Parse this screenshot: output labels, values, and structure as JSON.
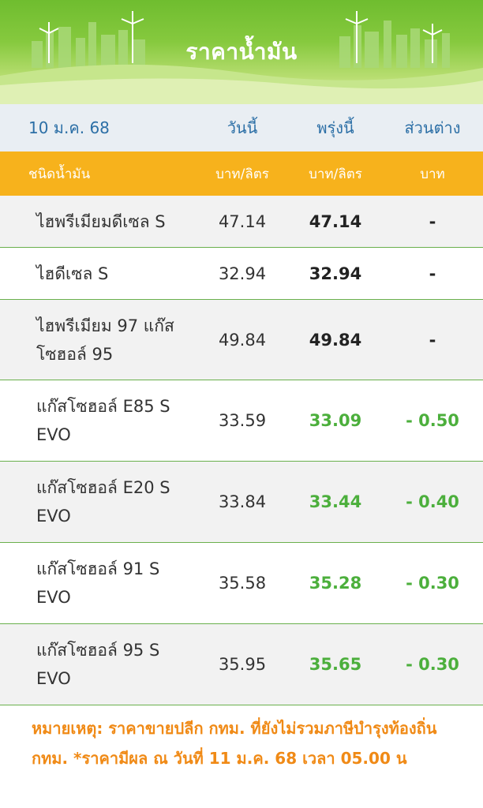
{
  "banner": {
    "title": "ราคาน้ำมัน"
  },
  "header": {
    "date": "10 ม.ค. 68",
    "today": "วันนี้",
    "tomorrow": "พรุ่งนี้",
    "diff": "ส่วนต่าง"
  },
  "columns": {
    "fuel_type": "ชนิดน้ำมัน",
    "today_unit": "บาท/ลิตร",
    "tomorrow_unit": "บาท/ลิตร",
    "diff_unit": "บาท"
  },
  "rows": [
    {
      "name": "ไฮพรีเมียมดีเซล S",
      "today": "47.14",
      "tomorrow": "47.14",
      "diff": "-",
      "trend": "same"
    },
    {
      "name": "ไฮดีเซล S",
      "today": "32.94",
      "tomorrow": "32.94",
      "diff": "-",
      "trend": "same"
    },
    {
      "name": "ไฮพรีเมียม 97 แก๊สโซฮอล์ 95",
      "today": "49.84",
      "tomorrow": "49.84",
      "diff": "-",
      "trend": "same"
    },
    {
      "name": "แก๊สโซฮอล์ E85 S EVO",
      "today": "33.59",
      "tomorrow": "33.09",
      "diff": "- 0.50",
      "trend": "down"
    },
    {
      "name": "แก๊สโซฮอล์ E20 S EVO",
      "today": "33.84",
      "tomorrow": "33.44",
      "diff": "- 0.40",
      "trend": "down"
    },
    {
      "name": "แก๊สโซฮอล์ 91 S EVO",
      "today": "35.58",
      "tomorrow": "35.28",
      "diff": "- 0.30",
      "trend": "down"
    },
    {
      "name": "แก๊สโซฮอล์ 95 S EVO",
      "today": "35.95",
      "tomorrow": "35.65",
      "diff": "- 0.30",
      "trend": "down"
    }
  ],
  "note": "หมายเหตุ: ราคาขายปลีก กทม. ที่ยังไม่รวมภาษีบำรุงท้องถิ่น กทม. *ราคามีผล ณ วันที่ 11 ม.ค. 68 เวลา 05.00 น",
  "colors": {
    "accent": "#f7b21c",
    "down": "#4caf3c",
    "divider": "#6ab04c",
    "note": "#f08a16",
    "header_text": "#2c6fa6"
  }
}
